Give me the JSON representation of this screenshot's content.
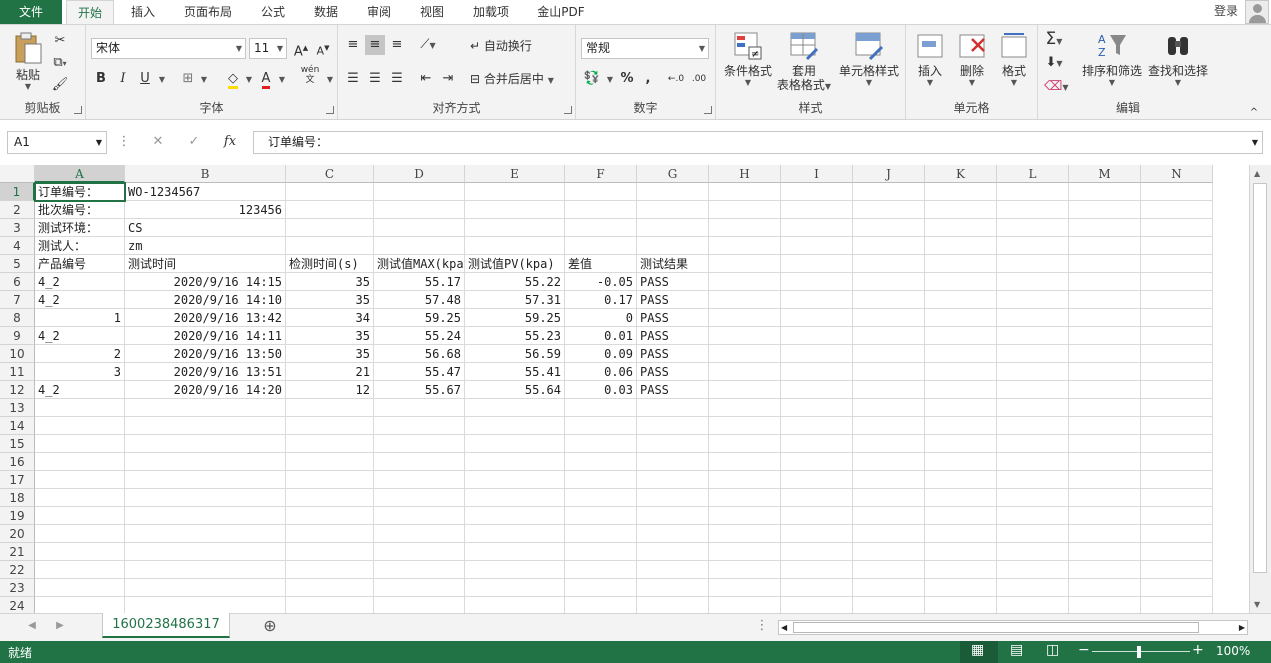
{
  "tabs": [
    "文件",
    "开始",
    "插入",
    "页面布局",
    "公式",
    "数据",
    "审阅",
    "视图",
    "加载项",
    "金山PDF"
  ],
  "account": {
    "login": "登录"
  },
  "ribbon": {
    "clipboard": {
      "label": "剪贴板",
      "paste": "粘贴"
    },
    "font": {
      "label": "字体",
      "name": "宋体",
      "size": "11",
      "bold": "B",
      "italic": "I",
      "underline": "U",
      "wen": "wén",
      "wenzi": "文"
    },
    "align": {
      "label": "对齐方式",
      "wrap": "自动换行",
      "merge": "合并后居中"
    },
    "number": {
      "label": "数字",
      "format": "常规"
    },
    "styles": {
      "label": "样式",
      "cond": "条件格式",
      "table1": "套用",
      "table2": "表格格式",
      "cell": "单元格样式"
    },
    "cells": {
      "label": "单元格",
      "insert": "插入",
      "delete": "删除",
      "format": "格式"
    },
    "edit": {
      "label": "编辑",
      "sort": "排序和筛选",
      "find": "查找和选择"
    }
  },
  "formula_bar": {
    "name_box": "A1",
    "fx": "fx",
    "content": "订单编号："
  },
  "columns": [
    "A",
    "B",
    "C",
    "D",
    "E",
    "F",
    "G",
    "H",
    "I",
    "J",
    "K",
    "L",
    "M",
    "N"
  ],
  "rows": [
    "1",
    "2",
    "3",
    "4",
    "5",
    "6",
    "7",
    "8",
    "9",
    "10",
    "11",
    "12",
    "13",
    "14",
    "15",
    "16",
    "17",
    "18",
    "19",
    "20",
    "21",
    "22",
    "23",
    "24"
  ],
  "cells": [
    [
      "订单编号：",
      "WO-1234567",
      "",
      "",
      "",
      "",
      ""
    ],
    [
      "批次编号：",
      "123456",
      "",
      "",
      "",
      "",
      ""
    ],
    [
      "测试环境：",
      "CS",
      "",
      "",
      "",
      "",
      ""
    ],
    [
      "测试人：",
      "zm",
      "",
      "",
      "",
      "",
      ""
    ],
    [
      "产品编号",
      "测试时间",
      "检测时间(s)",
      "测试值MAX(kpa)",
      "测试值PV(kpa)",
      "差值",
      "测试结果"
    ],
    [
      "4_2",
      "2020/9/16 14:15",
      "35",
      "55.17",
      "55.22",
      "-0.05",
      "PASS"
    ],
    [
      "4_2",
      "2020/9/16 14:10",
      "35",
      "57.48",
      "57.31",
      "0.17",
      "PASS"
    ],
    [
      "1",
      "2020/9/16 13:42",
      "34",
      "59.25",
      "59.25",
      "0",
      "PASS"
    ],
    [
      "4_2",
      "2020/9/16 14:11",
      "35",
      "55.24",
      "55.23",
      "0.01",
      "PASS"
    ],
    [
      "2",
      "2020/9/16 13:50",
      "35",
      "56.68",
      "56.59",
      "0.09",
      "PASS"
    ],
    [
      "3",
      "2020/9/16 13:51",
      "21",
      "55.47",
      "55.41",
      "0.06",
      "PASS"
    ],
    [
      "4_2",
      "2020/9/16 14:20",
      "12",
      "55.67",
      "55.64",
      "0.03",
      "PASS"
    ]
  ],
  "sheet": {
    "name": "1600238486317"
  },
  "status": {
    "ready": "就绪",
    "zoom": "100%"
  }
}
